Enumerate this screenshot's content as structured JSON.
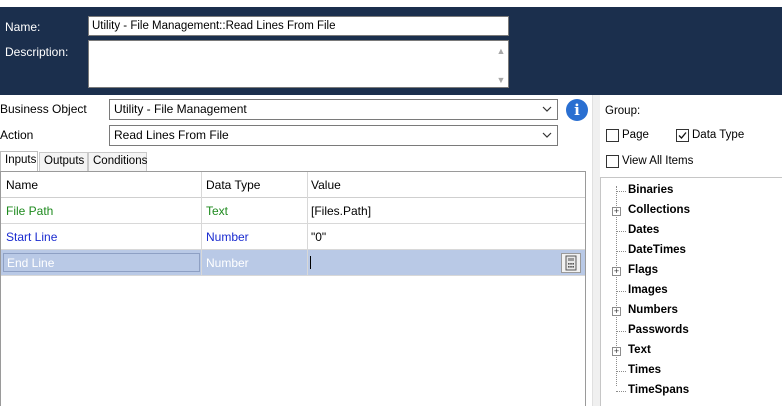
{
  "header": {
    "name_label": "Name:",
    "name_value": "Utility - File Management::Read Lines From File",
    "description_label": "Description:",
    "description_value": ""
  },
  "form": {
    "business_object_label": "Business Object",
    "business_object_value": "Utility - File Management",
    "action_label": "Action",
    "action_value": "Read Lines From File"
  },
  "tabs": [
    {
      "label": "Inputs",
      "active": true
    },
    {
      "label": "Outputs",
      "active": false
    },
    {
      "label": "Conditions",
      "active": false
    }
  ],
  "grid": {
    "columns": [
      "Name",
      "Data Type",
      "Value"
    ],
    "rows": [
      {
        "name": "File Path",
        "type": "Text",
        "value": "[Files.Path]",
        "color": "#1e8a1e"
      },
      {
        "name": "Start Line",
        "type": "Number",
        "value": "\"0\"",
        "color": "#1a2bd0"
      },
      {
        "name": "End Line",
        "type": "Number",
        "value": "",
        "selected": true
      }
    ]
  },
  "side": {
    "group_label": "Group:",
    "page_label": "Page",
    "page_checked": false,
    "datatype_label": "Data Type",
    "datatype_checked": true,
    "view_all_label": "View All Items",
    "view_all_checked": false,
    "tree": [
      {
        "label": "Binaries",
        "expandable": false
      },
      {
        "label": "Collections",
        "expandable": true
      },
      {
        "label": "Dates",
        "expandable": false
      },
      {
        "label": "DateTimes",
        "expandable": false
      },
      {
        "label": "Flags",
        "expandable": true
      },
      {
        "label": "Images",
        "expandable": false
      },
      {
        "label": "Numbers",
        "expandable": true
      },
      {
        "label": "Passwords",
        "expandable": false
      },
      {
        "label": "Text",
        "expandable": true
      },
      {
        "label": "Times",
        "expandable": false
      },
      {
        "label": "TimeSpans",
        "expandable": false
      }
    ]
  },
  "colors": {
    "header_bg": "#1b2f4d",
    "selected_row": "#b9c9e6",
    "text_type": "#1e8a1e",
    "number_type": "#1a2bd0",
    "info_icon": "#2a6fd1"
  }
}
